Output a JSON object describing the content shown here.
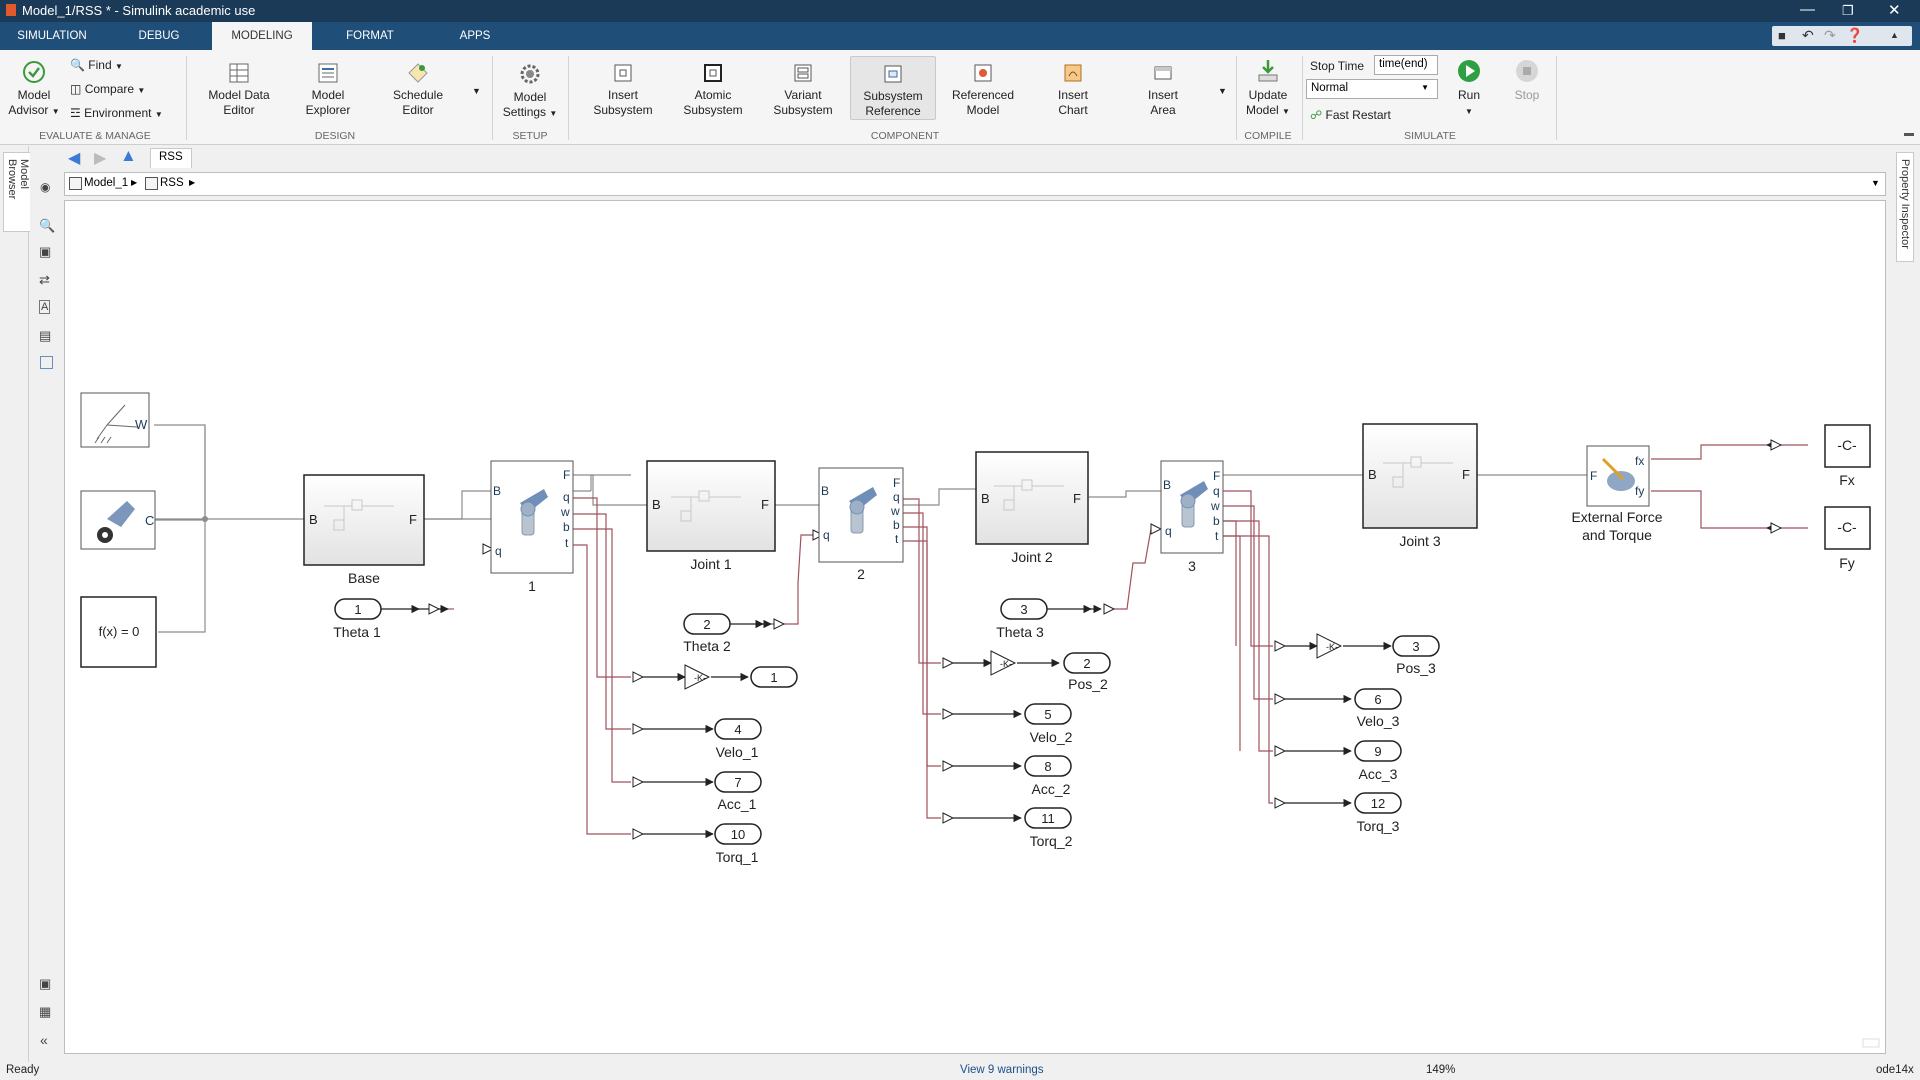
{
  "window": {
    "title": "Model_1/RSS * - Simulink academic use"
  },
  "tabs": [
    "SIMULATION",
    "DEBUG",
    "MODELING",
    "FORMAT",
    "APPS"
  ],
  "ribbon": {
    "evaluate": {
      "model_advisor_1": "Model",
      "model_advisor_2": "Advisor",
      "find": "Find",
      "compare": "Compare",
      "environment": "Environment",
      "section": "EVALUATE & MANAGE"
    },
    "design": {
      "mde_1": "Model Data",
      "mde_2": "Editor",
      "me_1": "Model",
      "me_2": "Explorer",
      "se_1": "Schedule",
      "se_2": "Editor",
      "section": "DESIGN"
    },
    "setup": {
      "ms_1": "Model",
      "ms_2": "Settings",
      "section": "SETUP"
    },
    "component": {
      "is_1": "Insert",
      "is_2": "Subsystem",
      "as_1": "Atomic",
      "as_2": "Subsystem",
      "vs_1": "Variant",
      "vs_2": "Subsystem",
      "sr_1": "Subsystem",
      "sr_2": "Reference",
      "rm_1": "Referenced",
      "rm_2": "Model",
      "ic_1": "Insert",
      "ic_2": "Chart",
      "ia_1": "Insert",
      "ia_2": "Area",
      "section": "COMPONENT"
    },
    "compile": {
      "um_1": "Update",
      "um_2": "Model",
      "section": "COMPILE"
    },
    "simulate": {
      "stop_time_label": "Stop Time",
      "stop_time_value": "time(end)",
      "mode": "Normal",
      "fast_restart": "Fast Restart",
      "run": "Run",
      "stop": "Stop",
      "section": "SIMULATE"
    }
  },
  "left_panel": {
    "model_browser": "Model Browser"
  },
  "right_panel": {
    "property_inspector": "Property Inspector"
  },
  "nav": {
    "tab": "RSS"
  },
  "breadcrumb": {
    "model": "Model_1",
    "subsystem": "RSS"
  },
  "diagram": {
    "world_port": "W",
    "config_port": "C",
    "solver_label": "f(x) = 0",
    "base_label": "Base",
    "port_b": "B",
    "port_f": "F",
    "port_q": "q",
    "port_w": "w",
    "port_b_small": "b",
    "port_t": "t",
    "rev1_label": "1",
    "rev2_label": "2",
    "rev3_label": "3",
    "joint1_label": "Joint 1",
    "joint2_label": "Joint 2",
    "joint3_label": "Joint 3",
    "ext_force_label_1": "External Force",
    "ext_force_label_2": "and Torque",
    "port_fx": "fx",
    "port_fy": "fy",
    "const_text": "-C-",
    "fx_label": "Fx",
    "fy_label": "Fy",
    "inports": [
      {
        "num": "1",
        "label": "Theta 1"
      },
      {
        "num": "2",
        "label": "Theta 2"
      },
      {
        "num": "3",
        "label": "Theta 3"
      }
    ],
    "outports": [
      {
        "num": "1",
        "label": ""
      },
      {
        "num": "4",
        "label": "Velo_1"
      },
      {
        "num": "7",
        "label": "Acc_1"
      },
      {
        "num": "10",
        "label": "Torq_1"
      },
      {
        "num": "2",
        "label": "Pos_2"
      },
      {
        "num": "5",
        "label": "Velo_2"
      },
      {
        "num": "8",
        "label": "Acc_2"
      },
      {
        "num": "11",
        "label": "Torq_2"
      },
      {
        "num": "3",
        "label": "Pos_3"
      },
      {
        "num": "6",
        "label": "Velo_3"
      },
      {
        "num": "9",
        "label": "Acc_3"
      },
      {
        "num": "12",
        "label": "Torq_3"
      }
    ],
    "gain_text": "-K-"
  },
  "status": {
    "left": "Ready",
    "warnings": "View 9 warnings",
    "zoom": "149%",
    "solver": "ode14x"
  },
  "colors": {
    "titlebar": "#1b3a57",
    "tabbar": "#1f4e79",
    "signal_line": "#a0525c",
    "conn_line": "#8c8c8c",
    "run_green": "#2ea043"
  }
}
